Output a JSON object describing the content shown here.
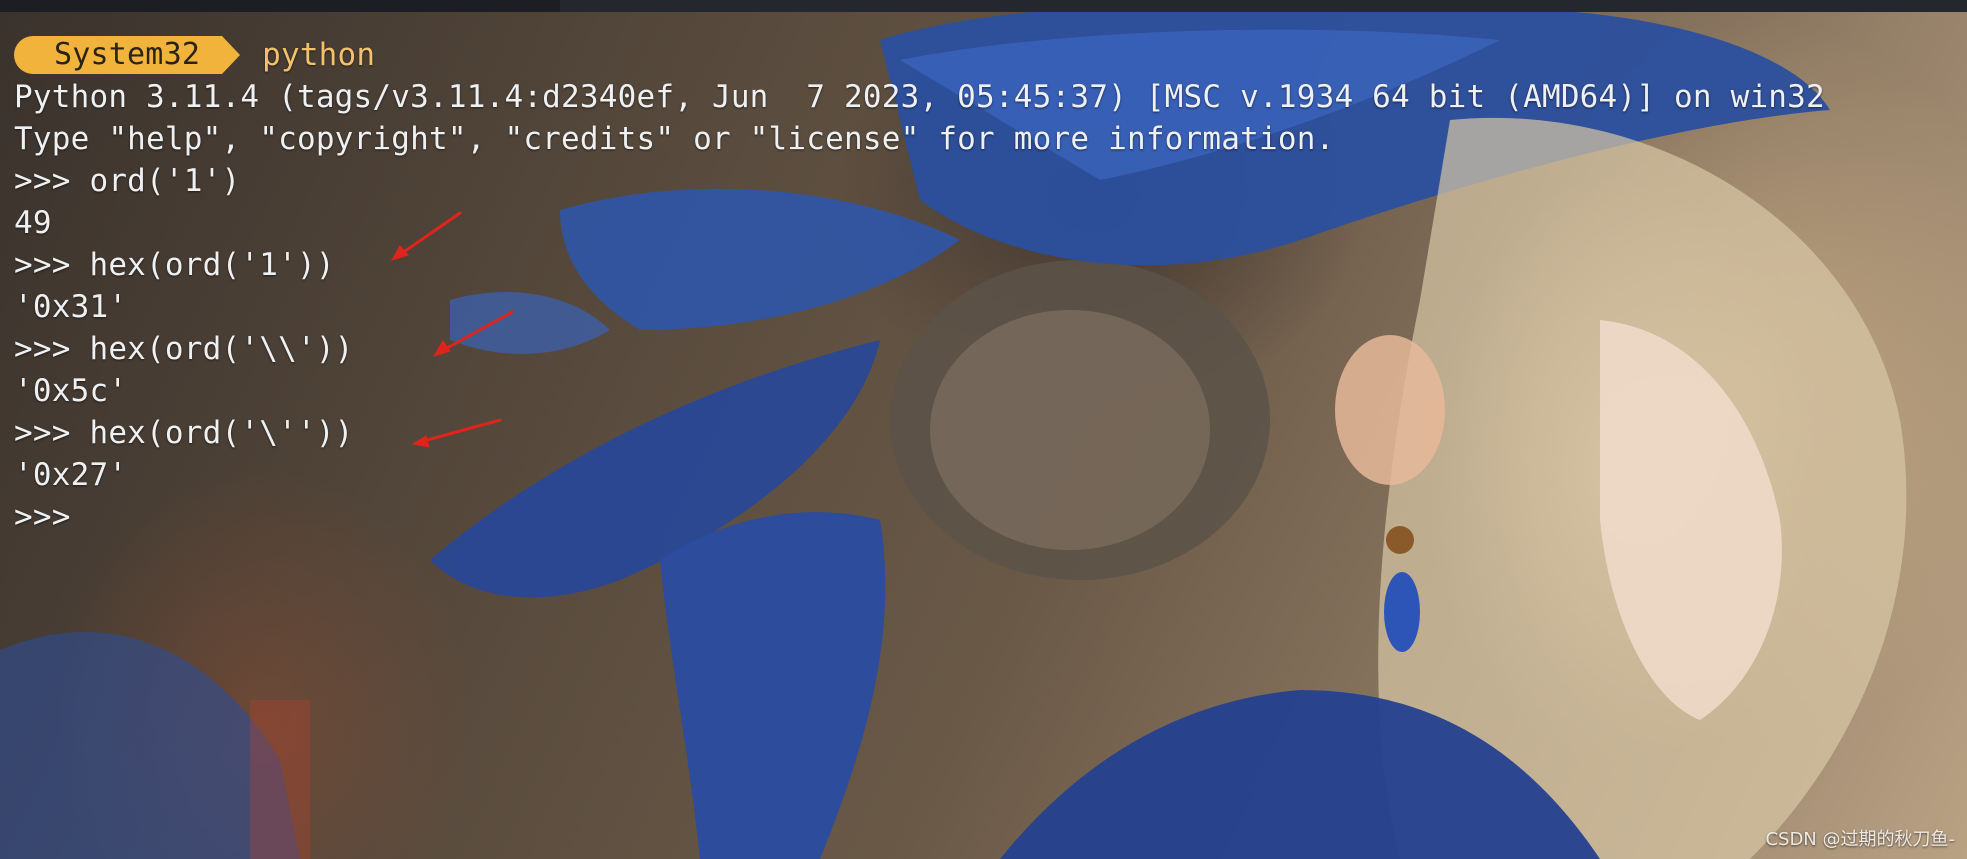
{
  "prompt": {
    "directory": "System32",
    "command": "python"
  },
  "output_lines": [
    "Python 3.11.4 (tags/v3.11.4:d2340ef, Jun  7 2023, 05:45:37) [MSC v.1934 64 bit (AMD64)] on win32",
    "Type \"help\", \"copyright\", \"credits\" or \"license\" for more information.",
    ">>> ord('1')",
    "49",
    ">>> hex(ord('1'))",
    "'0x31'",
    ">>> hex(ord('\\\\'))",
    "'0x5c'",
    ">>> hex(ord('\\''))",
    "'0x27'",
    ">>>"
  ],
  "watermark": "CSDN @过期的秋刀鱼-",
  "colors": {
    "prompt_pill": "#f2b33d",
    "command_text": "#f2c26a",
    "terminal_text": "#eef0f2",
    "annotation_arrow": "#e0241c"
  }
}
